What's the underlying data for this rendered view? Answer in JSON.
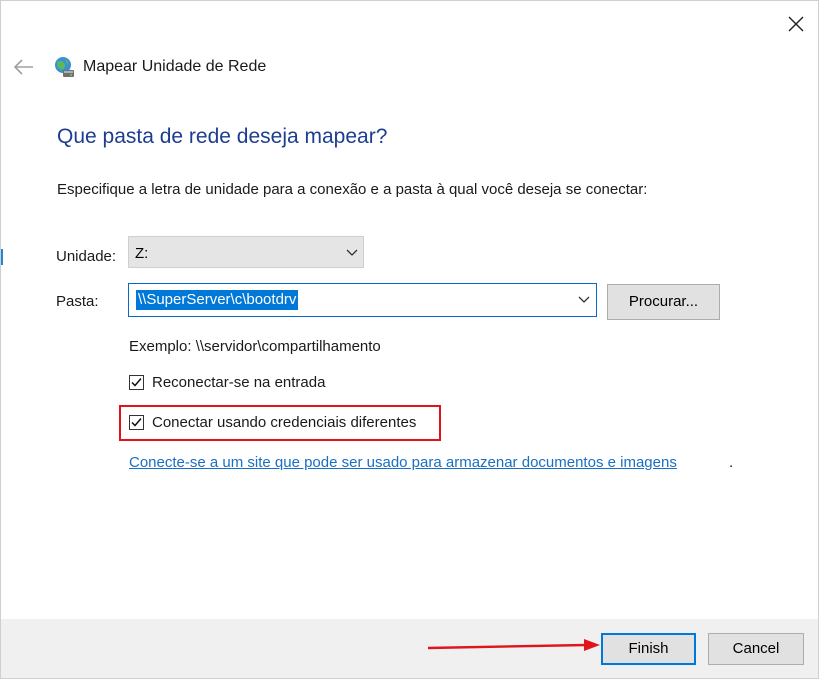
{
  "window": {
    "title": "Mapear Unidade de Rede",
    "close_icon": "close-icon",
    "back_icon": "back-arrow-icon",
    "app_icon": "network-drive-icon"
  },
  "main": {
    "heading": "Que pasta de rede deseja mapear?",
    "instructions": "Especifique a letra de unidade para a conexão e a pasta à qual você deseja se conectar:",
    "drive": {
      "label": "Unidade:",
      "value": "Z:"
    },
    "folder": {
      "label": "Pasta:",
      "value": "\\\\SuperServer\\c\\bootdrv"
    },
    "browse_label": "Procurar...",
    "example": "Exemplo: \\\\servidor\\compartilhamento",
    "reconnect": {
      "label": "Reconectar-se na entrada",
      "checked": true
    },
    "credentials": {
      "label": "Conectar usando credenciais diferentes",
      "checked": true
    },
    "link": "Conecte-se a um site que pode ser usado para armazenar documentos e imagens",
    "link_suffix": "."
  },
  "footer": {
    "finish_label": "Finish",
    "cancel_label": "Cancel"
  },
  "annotation_color": "#e0141c",
  "accent_color": "#0078d7"
}
